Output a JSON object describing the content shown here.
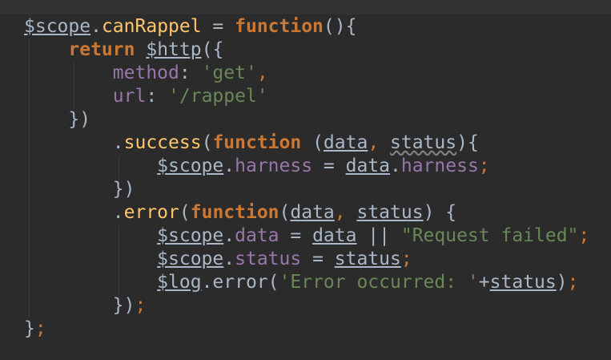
{
  "editor": {
    "line1": {
      "obj": "$scope",
      "prop": "canRappel",
      "op": " = ",
      "kw": "function",
      "tail": "(){"
    },
    "line2": {
      "kw": "return",
      "obj": "$http",
      "tail": "({"
    },
    "line3": {
      "key": "method",
      "colon": ": ",
      "val": "'get'",
      "comma": ","
    },
    "line4": {
      "key": "url",
      "colon": ": ",
      "val": "'/rappel'"
    },
    "line5": {
      "text": "})"
    },
    "line6": {
      "dot": ".",
      "method": "success",
      "open": "(",
      "kw": "function",
      "sp": " (",
      "arg1": "data",
      "comma": ", ",
      "arg2": "status",
      "close": "){"
    },
    "line7": {
      "obj": "$scope",
      "dot": ".",
      "prop": "harness",
      "op": " = ",
      "src": "data",
      "dot2": ".",
      "prop2": "harness",
      "semi": ";"
    },
    "line8": {
      "text": "})"
    },
    "line9": {
      "dot": ".",
      "method": "error",
      "open": "(",
      "kw": "function",
      "paren": "(",
      "arg1": "data",
      "comma": ", ",
      "arg2": "status",
      "close": ") {"
    },
    "line10": {
      "obj": "$scope",
      "dot": ".",
      "prop": "data",
      "op": " = ",
      "src": "data",
      "or": " || ",
      "str": "\"Request failed\"",
      "semi": ";"
    },
    "line11": {
      "obj": "$scope",
      "dot": ".",
      "prop": "status",
      "op": " = ",
      "src": "status",
      "semi": ";"
    },
    "line12": {
      "obj": "$log",
      "dot": ".",
      "method": "error",
      "open": "(",
      "str": "'Error occurred: '",
      "plus": "+",
      "arg": "status",
      "close": ")",
      "semi": ";"
    },
    "line13": {
      "close": "})",
      "semi": ";"
    },
    "line14": {
      "close": "}",
      "semi": ";"
    }
  }
}
